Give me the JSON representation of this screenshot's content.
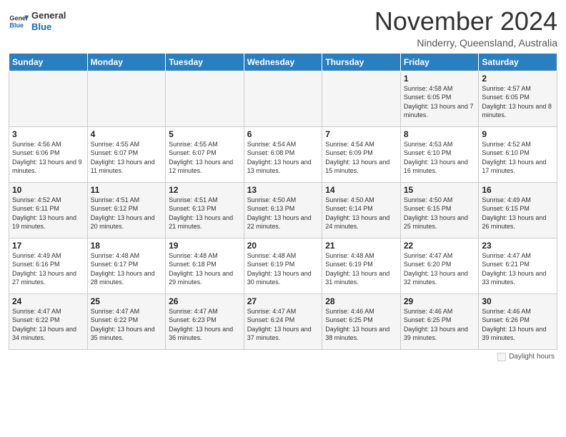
{
  "header": {
    "logo_text_general": "General",
    "logo_text_blue": "Blue",
    "month_title": "November 2024",
    "location": "Ninderry, Queensland, Australia"
  },
  "weekdays": [
    "Sunday",
    "Monday",
    "Tuesday",
    "Wednesday",
    "Thursday",
    "Friday",
    "Saturday"
  ],
  "footer": {
    "legend_label": "Daylight hours"
  },
  "weeks": [
    [
      {
        "day": "",
        "info": ""
      },
      {
        "day": "",
        "info": ""
      },
      {
        "day": "",
        "info": ""
      },
      {
        "day": "",
        "info": ""
      },
      {
        "day": "",
        "info": ""
      },
      {
        "day": "1",
        "info": "Sunrise: 4:58 AM\nSunset: 6:05 PM\nDaylight: 13 hours\nand 7 minutes."
      },
      {
        "day": "2",
        "info": "Sunrise: 4:57 AM\nSunset: 6:05 PM\nDaylight: 13 hours\nand 8 minutes."
      }
    ],
    [
      {
        "day": "3",
        "info": "Sunrise: 4:56 AM\nSunset: 6:06 PM\nDaylight: 13 hours\nand 9 minutes."
      },
      {
        "day": "4",
        "info": "Sunrise: 4:55 AM\nSunset: 6:07 PM\nDaylight: 13 hours\nand 11 minutes."
      },
      {
        "day": "5",
        "info": "Sunrise: 4:55 AM\nSunset: 6:07 PM\nDaylight: 13 hours\nand 12 minutes."
      },
      {
        "day": "6",
        "info": "Sunrise: 4:54 AM\nSunset: 6:08 PM\nDaylight: 13 hours\nand 13 minutes."
      },
      {
        "day": "7",
        "info": "Sunrise: 4:54 AM\nSunset: 6:09 PM\nDaylight: 13 hours\nand 15 minutes."
      },
      {
        "day": "8",
        "info": "Sunrise: 4:53 AM\nSunset: 6:10 PM\nDaylight: 13 hours\nand 16 minutes."
      },
      {
        "day": "9",
        "info": "Sunrise: 4:52 AM\nSunset: 6:10 PM\nDaylight: 13 hours\nand 17 minutes."
      }
    ],
    [
      {
        "day": "10",
        "info": "Sunrise: 4:52 AM\nSunset: 6:11 PM\nDaylight: 13 hours\nand 19 minutes."
      },
      {
        "day": "11",
        "info": "Sunrise: 4:51 AM\nSunset: 6:12 PM\nDaylight: 13 hours\nand 20 minutes."
      },
      {
        "day": "12",
        "info": "Sunrise: 4:51 AM\nSunset: 6:13 PM\nDaylight: 13 hours\nand 21 minutes."
      },
      {
        "day": "13",
        "info": "Sunrise: 4:50 AM\nSunset: 6:13 PM\nDaylight: 13 hours\nand 22 minutes."
      },
      {
        "day": "14",
        "info": "Sunrise: 4:50 AM\nSunset: 6:14 PM\nDaylight: 13 hours\nand 24 minutes."
      },
      {
        "day": "15",
        "info": "Sunrise: 4:50 AM\nSunset: 6:15 PM\nDaylight: 13 hours\nand 25 minutes."
      },
      {
        "day": "16",
        "info": "Sunrise: 4:49 AM\nSunset: 6:15 PM\nDaylight: 13 hours\nand 26 minutes."
      }
    ],
    [
      {
        "day": "17",
        "info": "Sunrise: 4:49 AM\nSunset: 6:16 PM\nDaylight: 13 hours\nand 27 minutes."
      },
      {
        "day": "18",
        "info": "Sunrise: 4:48 AM\nSunset: 6:17 PM\nDaylight: 13 hours\nand 28 minutes."
      },
      {
        "day": "19",
        "info": "Sunrise: 4:48 AM\nSunset: 6:18 PM\nDaylight: 13 hours\nand 29 minutes."
      },
      {
        "day": "20",
        "info": "Sunrise: 4:48 AM\nSunset: 6:19 PM\nDaylight: 13 hours\nand 30 minutes."
      },
      {
        "day": "21",
        "info": "Sunrise: 4:48 AM\nSunset: 6:19 PM\nDaylight: 13 hours\nand 31 minutes."
      },
      {
        "day": "22",
        "info": "Sunrise: 4:47 AM\nSunset: 6:20 PM\nDaylight: 13 hours\nand 32 minutes."
      },
      {
        "day": "23",
        "info": "Sunrise: 4:47 AM\nSunset: 6:21 PM\nDaylight: 13 hours\nand 33 minutes."
      }
    ],
    [
      {
        "day": "24",
        "info": "Sunrise: 4:47 AM\nSunset: 6:22 PM\nDaylight: 13 hours\nand 34 minutes."
      },
      {
        "day": "25",
        "info": "Sunrise: 4:47 AM\nSunset: 6:22 PM\nDaylight: 13 hours\nand 35 minutes."
      },
      {
        "day": "26",
        "info": "Sunrise: 4:47 AM\nSunset: 6:23 PM\nDaylight: 13 hours\nand 36 minutes."
      },
      {
        "day": "27",
        "info": "Sunrise: 4:47 AM\nSunset: 6:24 PM\nDaylight: 13 hours\nand 37 minutes."
      },
      {
        "day": "28",
        "info": "Sunrise: 4:46 AM\nSunset: 6:25 PM\nDaylight: 13 hours\nand 38 minutes."
      },
      {
        "day": "29",
        "info": "Sunrise: 4:46 AM\nSunset: 6:25 PM\nDaylight: 13 hours\nand 39 minutes."
      },
      {
        "day": "30",
        "info": "Sunrise: 4:46 AM\nSunset: 6:26 PM\nDaylight: 13 hours\nand 39 minutes."
      }
    ]
  ]
}
